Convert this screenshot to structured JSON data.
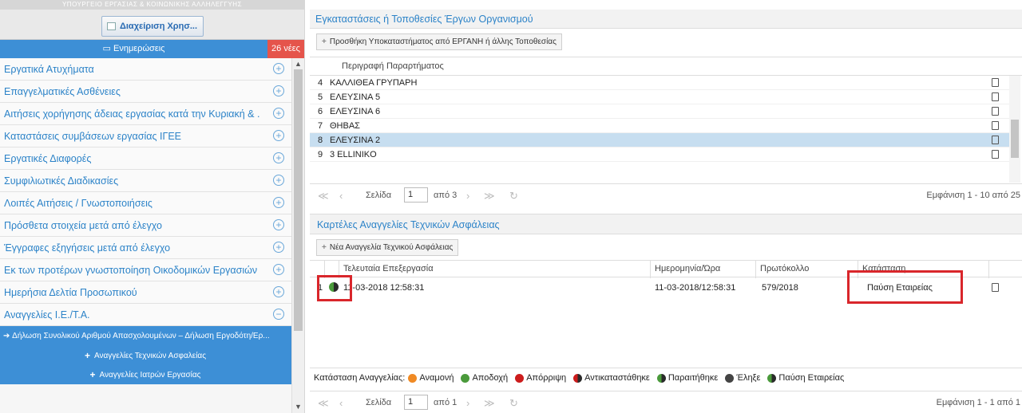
{
  "ministry_header": "ΥΠΟΥΡΓΕΙΟ ΕΡΓΑΣΙΑΣ & ΚΟΙΝΩΝΙΚΗΣ ΑΛΛΗΛΕΓΓΥΗΣ",
  "user_mgmt_label": "Διαχείριση Χρησ...",
  "notifications": {
    "label": "Ενημερώσεις",
    "badge": "26 νέες"
  },
  "menu": [
    "Εργατικά Ατυχήματα",
    "Επαγγελματικές Ασθένειες",
    "Αιτήσεις χορήγησης άδειας εργασίας κατά την Κυριακή & ...",
    "Καταστάσεις συμβάσεων εργασίας ΙΓΕΕ",
    "Εργατικές Διαφορές",
    "Συμφιλιωτικές Διαδικασίες",
    "Λοιπές Αιτήσεις / Γνωστοποιήσεις",
    "Πρόσθετα στοιχεία μετά από έλεγχο",
    "Έγγραφες εξηγήσεις μετά από έλεγχο",
    "Εκ των προτέρων γνωστοποίηση Οικοδομικών Εργασιών",
    "Ημερήσια Δελτία Προσωπικού",
    "Αναγγελίες Ι.Ε./Τ.Α."
  ],
  "submenu": {
    "header": "Δήλωση Συνολικού Αριθμού Απασχολουμένων – Δήλωση Εργοδότη/Ερ...",
    "item1": "Αναγγελίες Τεχνικών Ασφαλείας",
    "item2": "Αναγγελίες Ιατρών Εργασίας"
  },
  "panel1": {
    "title": "Εγκαταστάσεις ή Τοποθεσίες Έργων Οργανισμού",
    "button": "Προσθήκη Υποκαταστήματος από ΕΡΓΑΝΗ ή άλλης Τοποθεσίας",
    "column": "Περιγραφή Παραρτήματος",
    "rows": [
      {
        "n": "4",
        "t": "ΚΑΛΛΙΘΕΑ ΓΡΥΠΑΡΗ"
      },
      {
        "n": "5",
        "t": "ΕΛΕΥΣΙΝΑ 5"
      },
      {
        "n": "6",
        "t": "ΕΛΕΥΣΙΝΑ 6"
      },
      {
        "n": "7",
        "t": "ΘΗΒΑΣ"
      },
      {
        "n": "8",
        "t": "ΕΛΕΥΣΙΝΑ 2"
      },
      {
        "n": "9",
        "t": "3 ELLINIKO"
      }
    ],
    "pager": {
      "page_label": "Σελίδα",
      "page": "1",
      "of": "από 3",
      "info": "Εμφάνιση 1 - 10 από 25"
    }
  },
  "panel2": {
    "title": "Καρτέλες Αναγγελίες Τεχνικών Ασφάλειας",
    "button": "Νέα Αναγγελία Τεχνικού Ασφάλειας",
    "columns": {
      "last_edit": "Τελευταία Επεξεργασία",
      "datetime": "Ημερομηνία/Ώρα",
      "protocol": "Πρωτόκολλο",
      "status": "Κατάσταση"
    },
    "row": {
      "n": "1",
      "last_edit": "11-03-2018 12:58:31",
      "datetime": "11-03-2018/12:58:31",
      "protocol": "579/2018",
      "status": "Παύση Εταιρείας"
    },
    "legend_title": "Κατάσταση Αναγγελίας:",
    "legend": [
      {
        "label": "Αναμονή",
        "color": "#f08a24"
      },
      {
        "label": "Αποδοχή",
        "color": "#4a9a3b"
      },
      {
        "label": "Απόρριψη",
        "color": "#cc1c1c"
      },
      {
        "label": "Αντικαταστάθηκε",
        "color": "#cc1c1c"
      },
      {
        "label": "Παραιτήθηκε",
        "color": "#4a9a3b"
      },
      {
        "label": "Έληξε",
        "color": "#444444"
      },
      {
        "label": "Παύση Εταιρείας",
        "color": "#4a9a3b"
      }
    ],
    "pager": {
      "page_label": "Σελίδα",
      "page": "1",
      "of": "από 1",
      "info": "Εμφάνιση 1 - 1 από 1"
    }
  }
}
